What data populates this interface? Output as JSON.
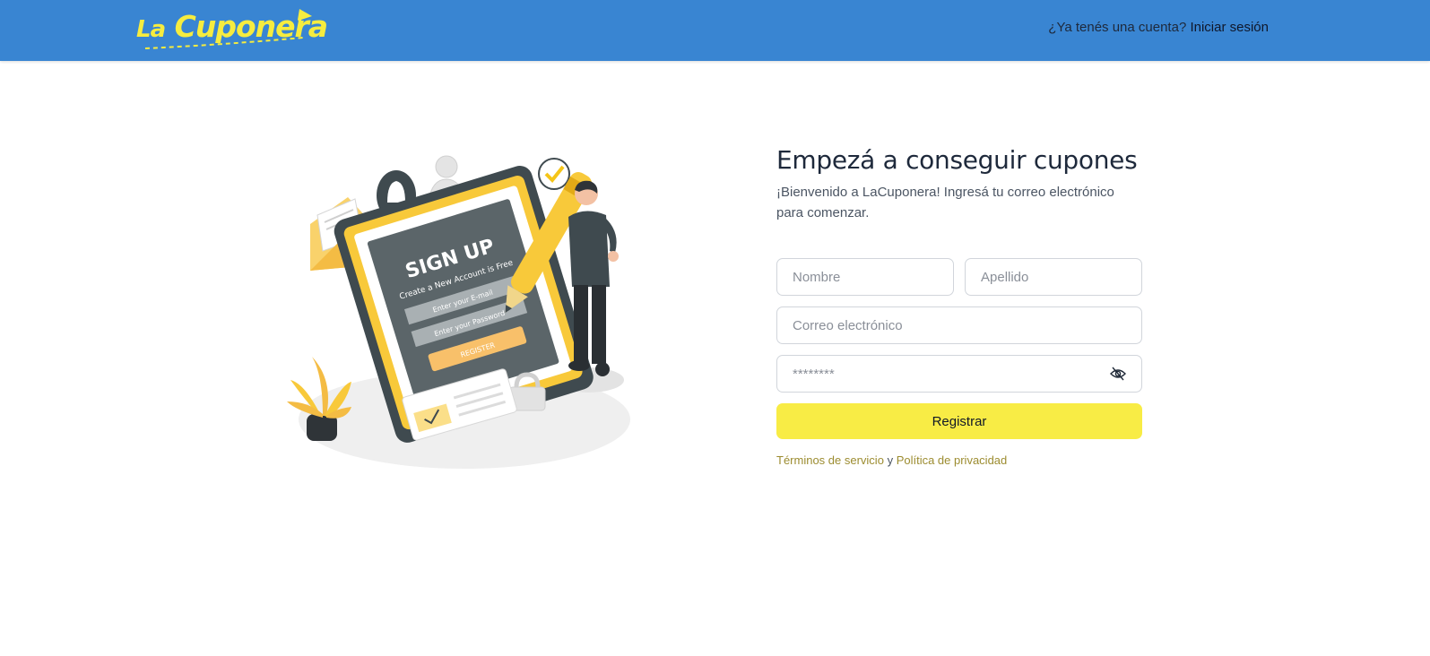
{
  "header": {
    "logo_text_prefix": "La",
    "logo_text_main": "Cuponera",
    "login_prompt": "¿Ya tenés una cuenta?",
    "login_link": "Iniciar sesión"
  },
  "illustration": {
    "heading": "SIGN UP",
    "subheading": "Create a New Account is Free",
    "email_field": "Enter your E-mail",
    "password_field": "Enter your Password",
    "button": "REGISTER"
  },
  "form": {
    "title": "Empezá a conseguir cupones",
    "subtitle": "¡Bienvenido a LaCuponera! Ingresá tu correo electrónico para comenzar.",
    "first_name_placeholder": "Nombre",
    "last_name_placeholder": "Apellido",
    "email_placeholder": "Correo electrónico",
    "password_placeholder": "********",
    "submit_label": "Registrar"
  },
  "legal": {
    "terms": "Términos de servicio",
    "and": "y",
    "privacy": "Política de privacidad"
  },
  "colors": {
    "header_bg": "#3985d2",
    "brand_yellow": "#f6ec3f",
    "button_yellow": "#f8ec45",
    "link_olive": "#9c8c30"
  }
}
